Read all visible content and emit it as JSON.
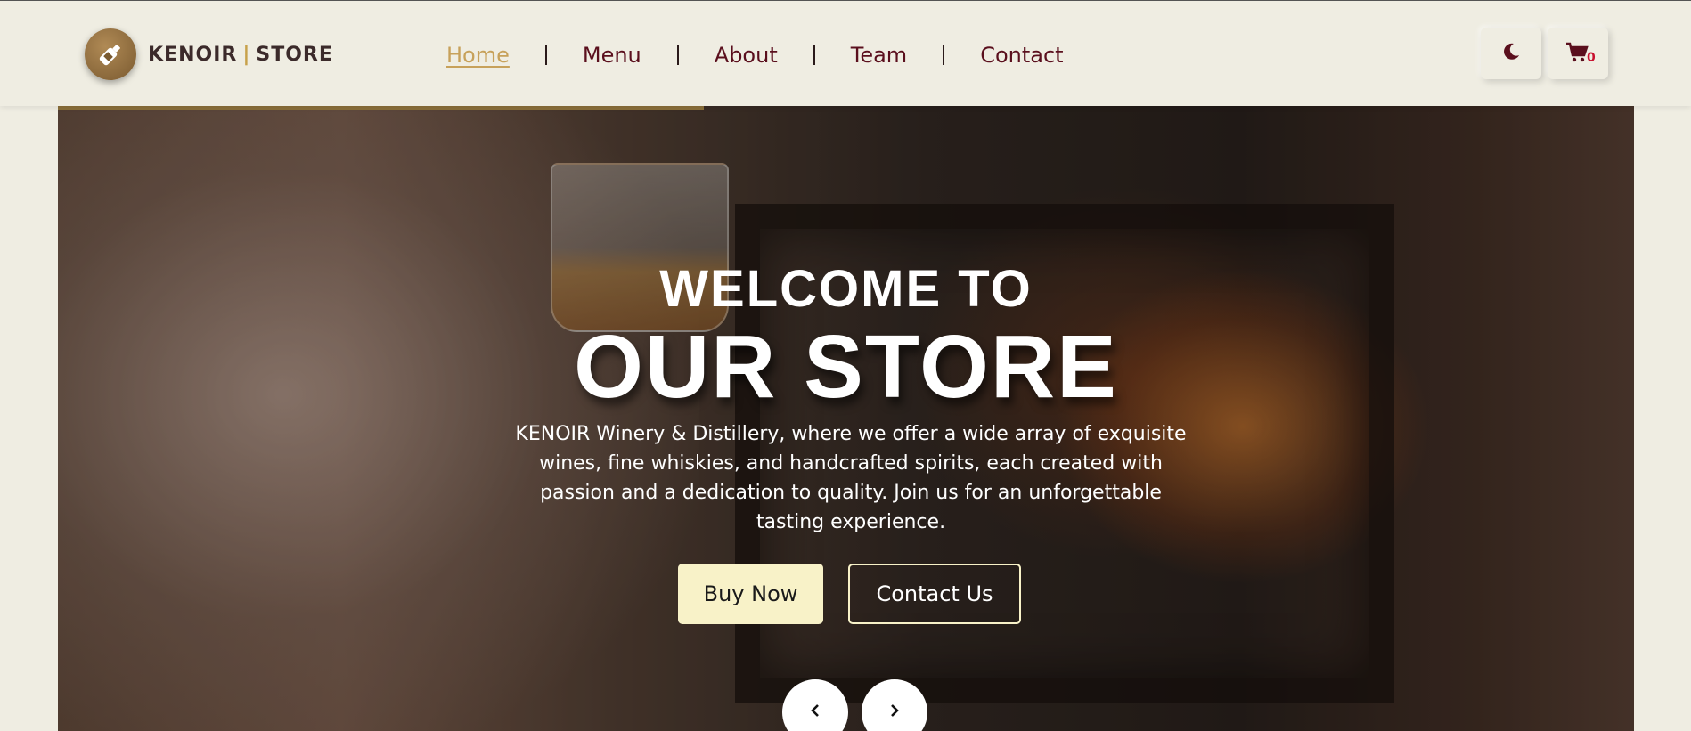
{
  "brand": {
    "name_left": "KENOIR",
    "separator": "|",
    "name_right": "STORE",
    "logo_icon": "bottle-icon"
  },
  "nav": {
    "items": [
      {
        "label": "Home",
        "active": true
      },
      {
        "label": "Menu",
        "active": false
      },
      {
        "label": "About",
        "active": false
      },
      {
        "label": "Team",
        "active": false
      },
      {
        "label": "Contact",
        "active": false
      }
    ]
  },
  "actions": {
    "theme_icon": "moon-icon",
    "cart_icon": "cart-icon",
    "cart_count": "0"
  },
  "slider": {
    "progress": 0.41
  },
  "hero": {
    "line1": "WELCOME TO",
    "line2": "OUR STORE",
    "description": "KENOIR Winery & Distillery, where we offer a wide array of exquisite wines, fine whiskies, and handcrafted spirits, each created with passion and a dedication to quality. Join us for an unforgettable tasting experience.",
    "primary_button": "Buy Now",
    "secondary_button": "Contact Us",
    "prev_icon": "chevron-left-icon",
    "next_icon": "chevron-right-icon"
  },
  "colors": {
    "background": "#efede2",
    "nav_text": "#5a0f1d",
    "nav_active": "#c7a15a",
    "accent_gold": "#c7a14a",
    "buy_button": "#f8f2c8",
    "cart_badge": "#c8102e"
  }
}
